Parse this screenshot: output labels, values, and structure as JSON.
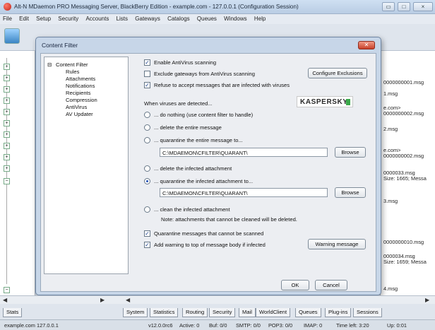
{
  "window": {
    "title": "Alt-N MDaemon PRO Messaging Server, BlackBerry Edition - example.com - 127.0.0.1 (Configuration Session)"
  },
  "menu": [
    "File",
    "Edit",
    "Setup",
    "Security",
    "Accounts",
    "Lists",
    "Gateways",
    "Catalogs",
    "Queues",
    "Windows",
    "Help"
  ],
  "right_pane": [
    "0000000001.msg",
    "1.msg",
    "e.com>",
    "0000000002.msg",
    "2.msg",
    "e.com>",
    "0000000002.msg",
    "0000033.msg",
    "Size: 1665; Messa",
    "3.msg",
    "0000000010.msg",
    "0000034.msg",
    "Size: 1659; Messa",
    "4.msg"
  ],
  "dialog": {
    "title": "Content Filter",
    "close_label": "✕",
    "tree": {
      "root": "Content Filter",
      "children": [
        "Rules",
        "Attachments",
        "Notifications",
        "Recipients",
        "Compression",
        "AntiVirus",
        "AV Updater"
      ]
    },
    "enable_av": "Enable AntiVirus scanning",
    "exclude_gateways": "Exclude gateways from AntiVirus scanning",
    "configure_exclusions": "Configure Exclusions",
    "refuse_infected": "Refuse to accept messages that are infected with viruses",
    "when_detected": "When viruses are detected...",
    "logo_text": "KASPERSKY",
    "opt_nothing": "... do nothing (use content filter to handle)",
    "opt_delete_msg": "... delete the entire message",
    "opt_quarantine_msg": "... quarantine the entire message to...",
    "quarantine_path_1": "C:\\MDAEMON\\CFILTER\\QUARANT\\",
    "browse_label": "Browse",
    "opt_delete_attach": "... delete the infected attachment",
    "opt_quarantine_attach": "... quarantine the infected attachment to...",
    "quarantine_path_2": "C:\\MDAEMON\\CFILTER\\QUARANT\\",
    "opt_clean_attach": "... clean the infected attachment",
    "clean_note": "Note: attachments that cannot be cleaned will be deleted.",
    "quarantine_unscannable": "Quarantine messages that cannot be scanned",
    "add_warning": "Add warning to top of message body if infected",
    "warning_message": "Warning message",
    "ok_label": "OK",
    "cancel_label": "Cancel"
  },
  "bottom_tabs": [
    "Stats",
    "System",
    "Statistics",
    "Routing",
    "Security",
    "Mail",
    "WorldClient",
    "Queues",
    "Plug-ins",
    "Sessions"
  ],
  "status": {
    "left": "example.com 127.0.0.1",
    "version": "v12.0.0rc6",
    "active": "Active: 0",
    "buf": "Buf: 0/0",
    "smtp": "SMTP: 0/0",
    "pop3": "POP3: 0/0",
    "imap": "IMAP: 0",
    "time_left": "Time left: 3:20",
    "up": "Up: 0:01"
  }
}
